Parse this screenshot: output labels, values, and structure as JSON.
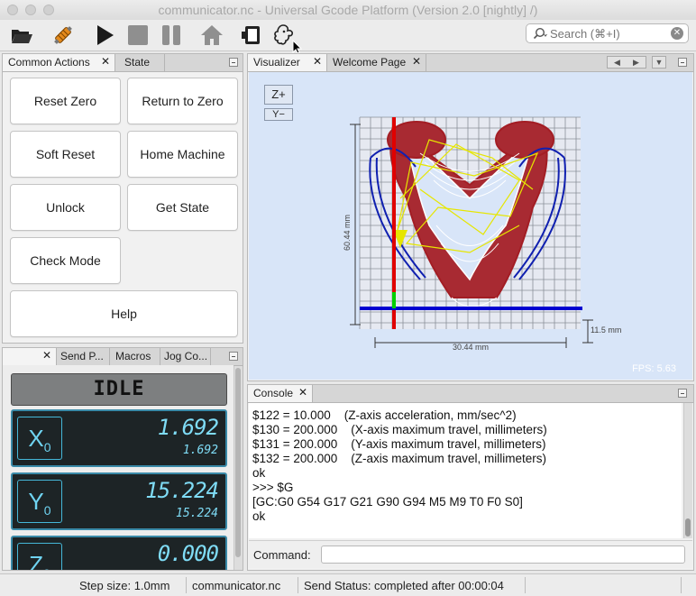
{
  "window": {
    "title": "communicator.nc - Universal Gcode Platform (Version 2.0 [nightly]  /)"
  },
  "toolbar": {
    "icons": [
      "open-folder-icon",
      "connect-plug-icon",
      "play-icon",
      "stop-icon",
      "pause-icon",
      "home-icon",
      "camera-icon",
      "octopus-plugin-icon"
    ],
    "search_placeholder": "Search (⌘+I)"
  },
  "actions_panel": {
    "tabs": [
      "Common Actions",
      "State"
    ],
    "buttons": {
      "reset_zero": "Reset Zero",
      "return_to_zero": "Return to Zero",
      "soft_reset": "Soft Reset",
      "home_machine": "Home Machine",
      "unlock": "Unlock",
      "get_state": "Get State",
      "check_mode": "Check Mode",
      "help": "Help"
    }
  },
  "dro_panel": {
    "tabs": [
      "",
      "Send P...",
      "Macros",
      "Jog Co..."
    ],
    "state": "IDLE",
    "axes": [
      {
        "axis": "X",
        "sub": "0",
        "work": "1.692",
        "machine": "1.692"
      },
      {
        "axis": "Y",
        "sub": "0",
        "work": "15.224",
        "machine": "15.224"
      },
      {
        "axis": "Z",
        "sub": "0",
        "work": "0.000",
        "machine": ""
      }
    ]
  },
  "visualizer": {
    "tabs": [
      "Visualizer",
      "Welcome Page"
    ],
    "z_plus": "Z+",
    "y_minus": "Y−",
    "dim_height": "60.44 mm",
    "dim_width": "30.44 mm",
    "dim_z": "11.5 mm",
    "fps": "FPS: 5.63"
  },
  "console": {
    "tab": "Console",
    "lines": [
      "$122 = 10.000    (Z-axis acceleration, mm/sec^2)",
      "$130 = 200.000    (X-axis maximum travel, millimeters)",
      "$131 = 200.000    (Y-axis maximum travel, millimeters)",
      "$132 = 200.000    (Z-axis maximum travel, millimeters)",
      "ok",
      ">>> $G",
      "[GC:G0 G54 G17 G21 G90 G94 M5 M9 T0 F0 S0]",
      "ok"
    ],
    "command_label": "Command:",
    "command_value": ""
  },
  "statusbar": {
    "step_size": "Step size: 1.0mm",
    "file": "communicator.nc",
    "send_status": "Send Status: completed after 00:00:04"
  },
  "colors": {
    "dro_accent": "#3a8aa8",
    "dro_text": "#7fdcf6",
    "viz_background": "#d8e5f8",
    "toolpath_red": "#a31d24",
    "toolpath_blue": "#1020b0",
    "toolpath_yellow": "#e6e600"
  }
}
